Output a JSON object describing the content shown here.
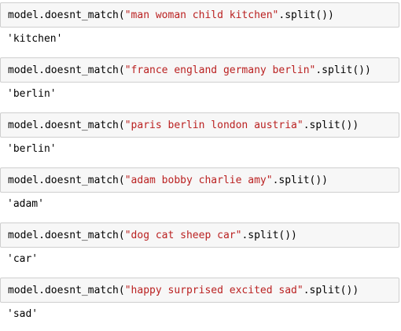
{
  "cells": [
    {
      "code_prefix": "model.doesnt_match(",
      "code_string": "\"man woman child kitchen\"",
      "code_suffix": ".split())",
      "output": "'kitchen'"
    },
    {
      "code_prefix": "model.doesnt_match(",
      "code_string": "\"france england germany berlin\"",
      "code_suffix": ".split())",
      "output": "'berlin'"
    },
    {
      "code_prefix": "model.doesnt_match(",
      "code_string": "\"paris berlin london austria\"",
      "code_suffix": ".split())",
      "output": "'berlin'"
    },
    {
      "code_prefix": "model.doesnt_match(",
      "code_string": "\"adam bobby charlie amy\"",
      "code_suffix": ".split())",
      "output": "'adam'"
    },
    {
      "code_prefix": "model.doesnt_match(",
      "code_string": "\"dog cat sheep car\"",
      "code_suffix": ".split())",
      "output": "'car'"
    },
    {
      "code_prefix": "model.doesnt_match(",
      "code_string": "\"happy surprised excited sad\"",
      "code_suffix": ".split())",
      "output": "'sad'"
    }
  ],
  "colors": {
    "input_background": "#f7f7f7",
    "input_border": "#cfcfcf",
    "string_literal": "#ba2121",
    "code_text": "#000000"
  }
}
